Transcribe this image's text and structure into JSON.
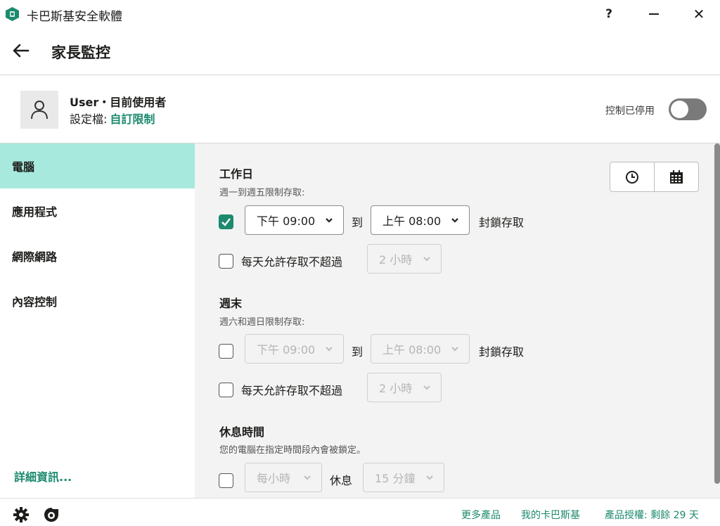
{
  "window": {
    "title": "卡巴斯基安全軟體",
    "help_label": "?",
    "close_label": "✕"
  },
  "header": {
    "title": "家長監控"
  },
  "profile": {
    "user_name": "User・目前使用者",
    "profile_label": "設定檔:",
    "profile_value": "自訂限制",
    "control_status": "控制已停用",
    "control_enabled": false
  },
  "sidebar": {
    "items": [
      {
        "label": "電腦",
        "active": true
      },
      {
        "label": "應用程式",
        "active": false
      },
      {
        "label": "網際網路",
        "active": false
      },
      {
        "label": "內容控制",
        "active": false
      }
    ],
    "more_info": "詳細資訊..."
  },
  "workdays": {
    "title": "工作日",
    "desc": "週一到週五限制存取:",
    "block_checked": true,
    "from": "下午 09:00",
    "to_label": "到",
    "to": "上午 08:00",
    "block_label": "封鎖存取",
    "limit_checked": false,
    "limit_label": "每天允許存取不超過",
    "limit_value": "2 小時"
  },
  "weekend": {
    "title": "週末",
    "desc": "週六和週日限制存取:",
    "block_checked": false,
    "from": "下午 09:00",
    "to_label": "到",
    "to": "上午 08:00",
    "block_label": "封鎖存取",
    "limit_checked": false,
    "limit_label": "每天允許存取不超過",
    "limit_value": "2 小時"
  },
  "breaks": {
    "title": "休息時間",
    "desc": "您的電腦在指定時間段內會被鎖定。",
    "checked": false,
    "interval": "每小時",
    "rest_label": "休息",
    "duration": "15 分鐘"
  },
  "footer": {
    "more_products": "更多產品",
    "my_kaspersky": "我的卡巴斯基",
    "license": "產品授權: 剩餘 29 天"
  },
  "colors": {
    "accent": "#1c8a6e",
    "sidebar_active": "#a7eadd",
    "main_bg": "#f3f3f3"
  }
}
